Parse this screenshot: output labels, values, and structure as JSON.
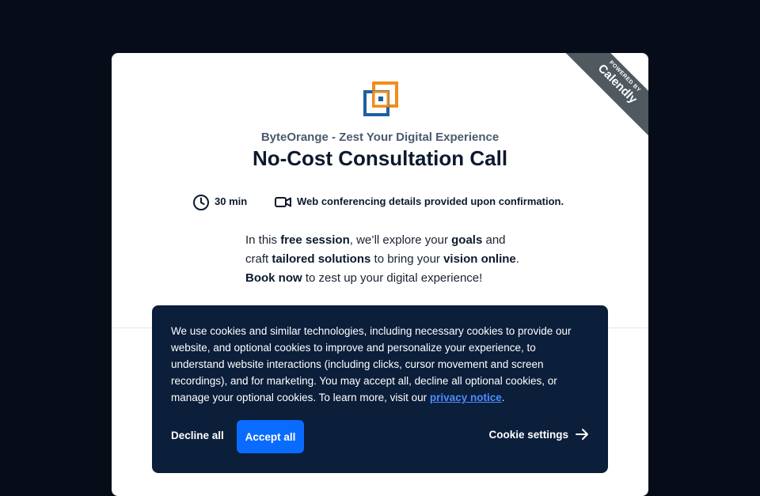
{
  "ribbon": {
    "powered_by": "POWERED BY",
    "name": "Calendly"
  },
  "brand": {
    "name": "ByteOrange - Zest Your Digital Experience",
    "logo_colors": {
      "blue": "#1f5fa0",
      "orange": "#f28c1c"
    }
  },
  "event": {
    "title": "No-Cost Consultation Call",
    "duration": "30 min",
    "location": "Web conferencing details provided upon confirmation.",
    "duration_icon": "clock-icon",
    "location_icon": "video-camera-icon",
    "description": {
      "p1": "In this ",
      "b1": "free session",
      "p2": ", we’ll explore your ",
      "b2": "goals",
      "p3": " and craft ",
      "b3": "tailored solutions",
      "p4": " to bring your ",
      "b4": "vision online",
      "p5": ". ",
      "b5": "Book now",
      "p6": " to zest up your digital experience!"
    }
  },
  "cookie_banner": {
    "text": "We use cookies and similar technologies, including necessary cookies to provide our website, and optional cookies to improve and personalize your experience, to understand website interactions (including clicks, cursor movement and screen recordings), and for marketing. You may accept all, decline all optional cookies, or manage your optional cookies. To learn more, visit our ",
    "link_text": "privacy notice",
    "text_end": ".",
    "decline_label": "Decline all",
    "accept_label": "Accept all",
    "settings_label": "Cookie settings",
    "settings_icon": "arrow-right-icon",
    "accent_color": "#0a6cff",
    "background_color": "#0b1e3a"
  }
}
